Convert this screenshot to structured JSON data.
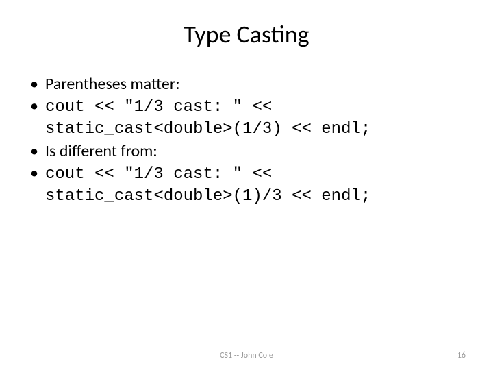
{
  "title": "Type Casting",
  "bullets": {
    "b1": "Parentheses matter:",
    "b2_line1": "cout << \"1/3 cast: \" <<",
    "b2_line2": "static_cast<double>(1/3) << endl;",
    "b3": "Is different from:",
    "b4_line1": "cout << \"1/3 cast: \" <<",
    "b4_line2": "static_cast<double>(1)/3 << endl;"
  },
  "footer": {
    "center": "CS1 -- John Cole",
    "page": "16"
  }
}
